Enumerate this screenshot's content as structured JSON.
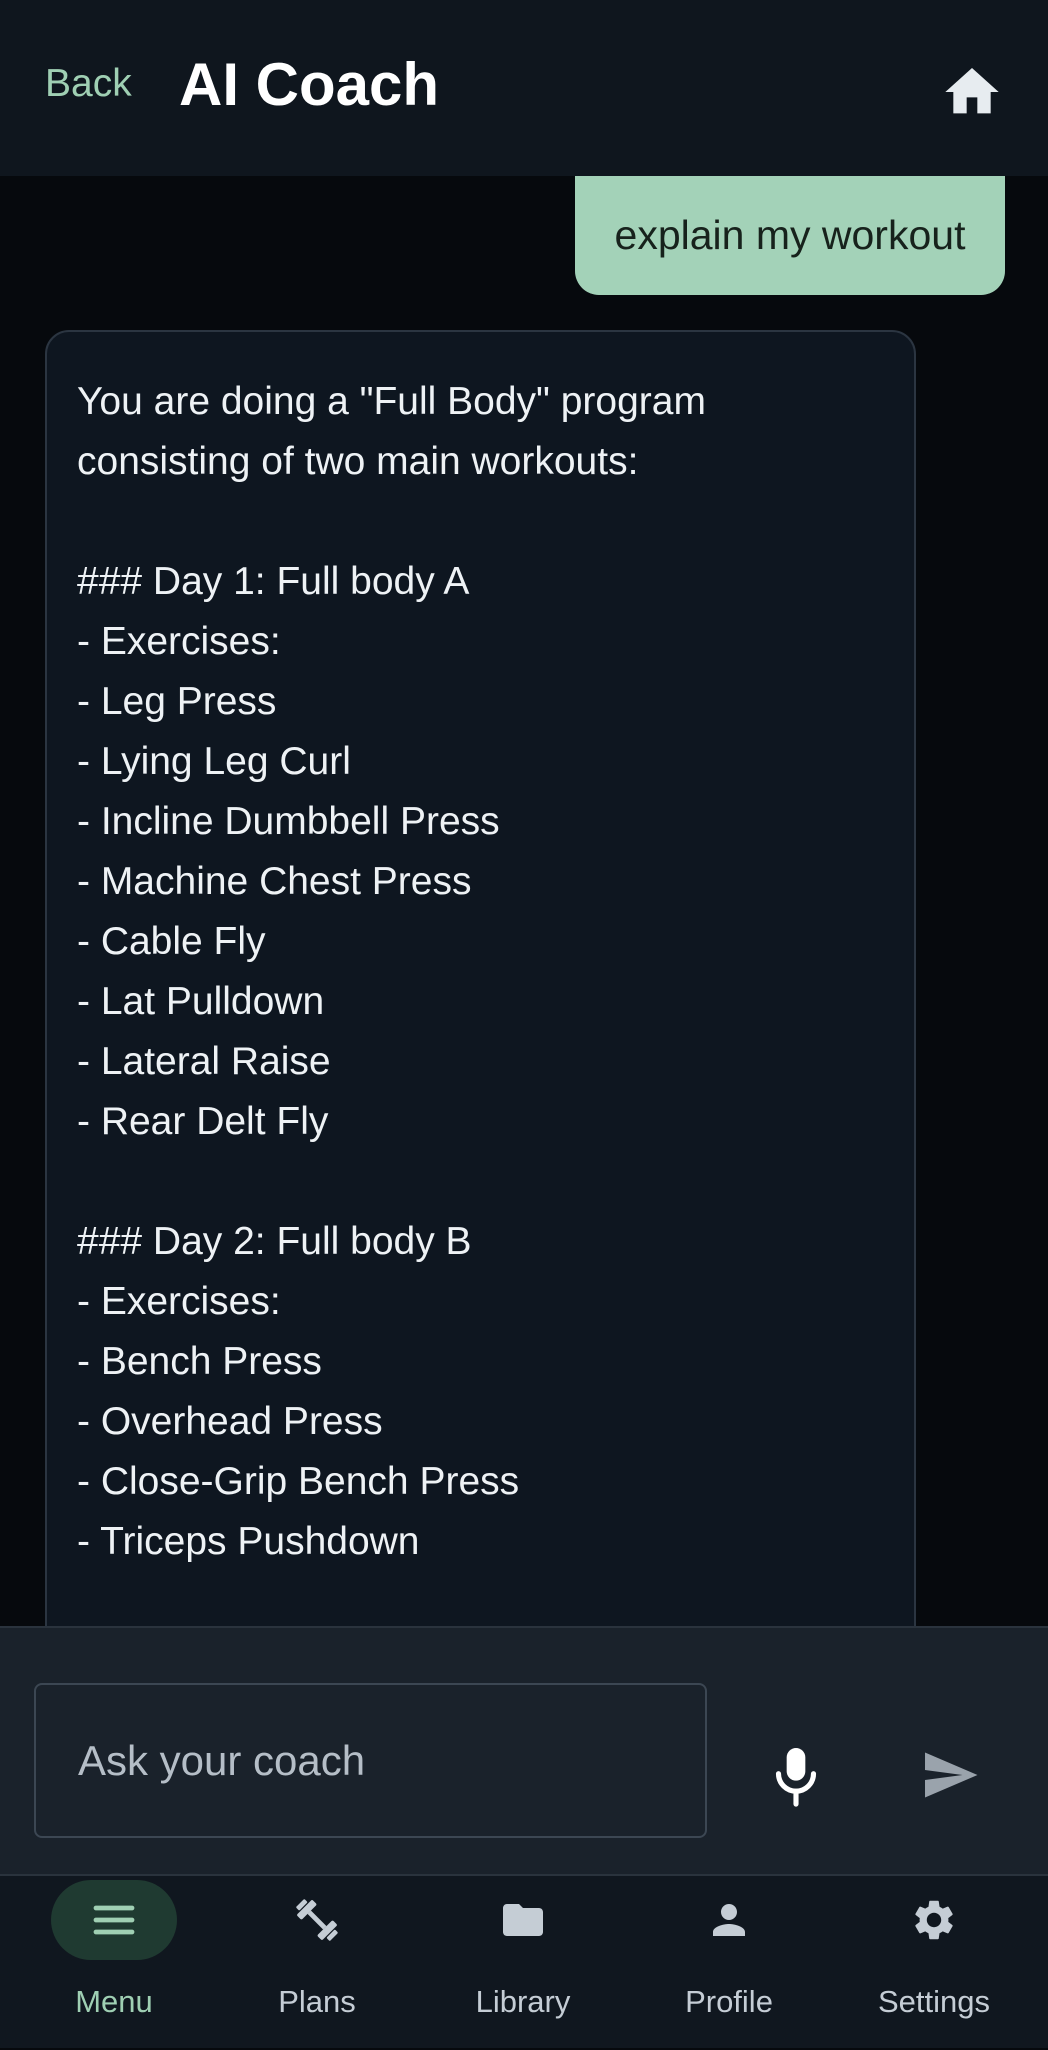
{
  "header": {
    "back_label": "Back",
    "title": "AI Coach"
  },
  "chat": {
    "user_message": "explain my workout",
    "ai_message": "You are doing a \"Full Body\" program consisting of two main workouts:\n\n### Day 1: Full body A\n- Exercises:\n- Leg Press\n- Lying Leg Curl\n- Incline Dumbbell Press\n- Machine Chest Press\n- Cable Fly\n- Lat Pulldown\n- Lateral Raise\n- Rear Delt Fly\n\n### Day 2: Full body B\n- Exercises:\n- Bench Press\n- Overhead Press\n- Close-Grip Bench Press\n- Triceps Pushdown"
  },
  "input": {
    "placeholder": "Ask your coach",
    "value": ""
  },
  "nav": {
    "items": [
      {
        "label": "Menu",
        "icon": "menu-icon",
        "active": true
      },
      {
        "label": "Plans",
        "icon": "dumbbell-icon",
        "active": false
      },
      {
        "label": "Library",
        "icon": "folder-icon",
        "active": false
      },
      {
        "label": "Profile",
        "icon": "person-icon",
        "active": false
      },
      {
        "label": "Settings",
        "icon": "gear-icon",
        "active": false
      }
    ]
  },
  "colors": {
    "accent": "#9fcfb3",
    "user_bubble": "#a3d2b8",
    "background": "#06090d",
    "header": "#0f161e"
  }
}
